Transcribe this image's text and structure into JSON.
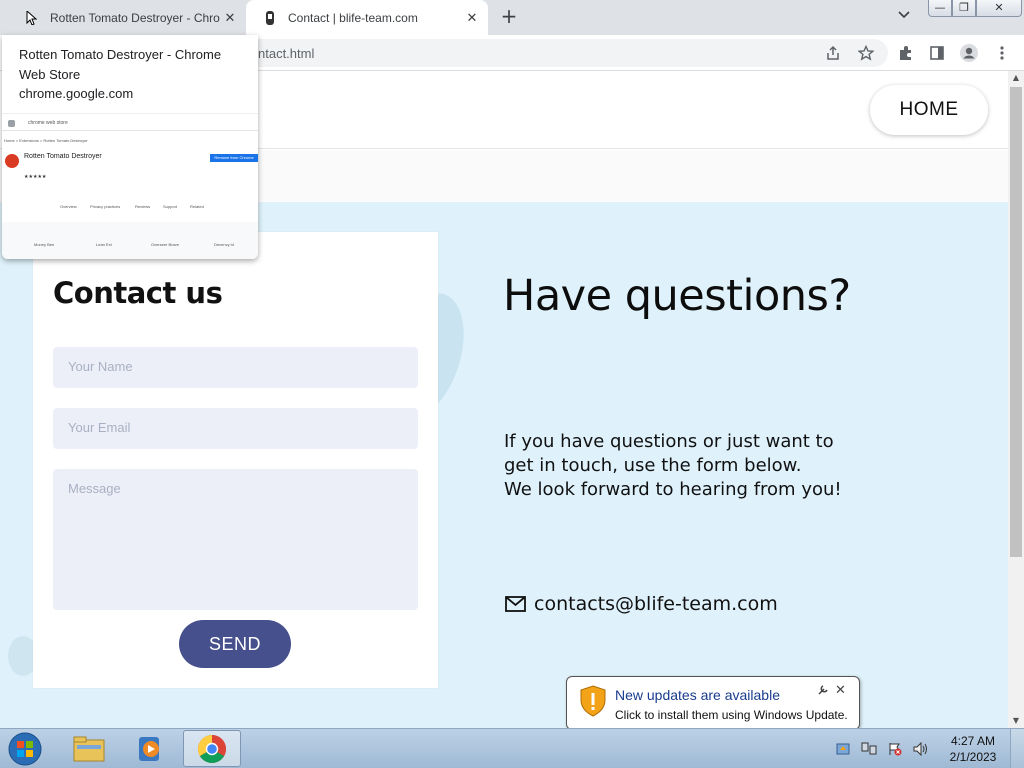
{
  "browser": {
    "tabs": [
      {
        "title": "Rotten Tomato Destroyer - Chrome Web Store",
        "close": "✕"
      },
      {
        "title": "Contact | blife-team.com",
        "close": "✕"
      }
    ],
    "new_tab": "+",
    "tab_search": "⌄",
    "window_buttons": {
      "minimize": "—",
      "restore": "❐",
      "close": "✕"
    },
    "url": "ntact.html"
  },
  "hover_card": {
    "title": "Rotten Tomato Destroyer - Chrome Web Store",
    "domain": "chrome.google.com",
    "preview": {
      "store": "chrome web store",
      "breadcrumb": "Home  >  Extensions  >  Rotten Tomato Destroyer",
      "ext_name": "Rotten Tomato Destroyer",
      "button": "Remove from Chrome",
      "tabs": [
        "Overview",
        "Privacy practices",
        "Reviews",
        "Support",
        "Related"
      ],
      "related": [
        "Money Bee",
        "Lean Ext",
        "Overseer Brave",
        "Decency ld"
      ]
    }
  },
  "site": {
    "nav": {
      "home": "HOME"
    },
    "form": {
      "heading": "Contact us",
      "name_placeholder": "Your Name",
      "email_placeholder": "Your Email",
      "message_placeholder": "Message",
      "send": "SEND"
    },
    "info": {
      "heading": "Have questions?",
      "lines": [
        "If you have questions or just want to",
        "get in touch, use the form below.",
        "We look forward to hearing from you!"
      ],
      "email": "contacts@blife-team.com"
    }
  },
  "notification": {
    "title": "New updates are available",
    "text": "Click to install them using Windows Update.",
    "close": "✕"
  },
  "taskbar": {
    "time": "4:27 AM",
    "date": "2/1/2023"
  },
  "colors": {
    "hero_bg": "#dff2fb",
    "send_button": "#46508c",
    "field_bg": "#eceff8"
  }
}
